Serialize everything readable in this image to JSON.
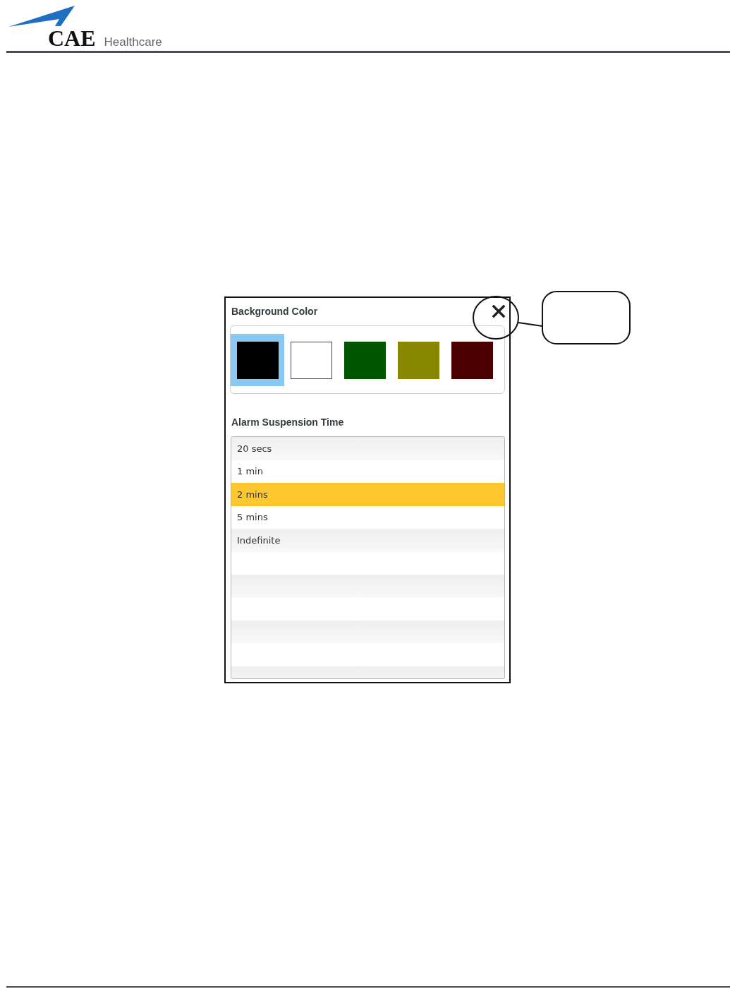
{
  "header": {
    "logo_text": "CAE",
    "logo_subtext": "Healthcare"
  },
  "dialog": {
    "background_color": {
      "label": "Background Color",
      "swatches": [
        {
          "color": "#000000",
          "selected": true
        },
        {
          "color": "#ffffff",
          "selected": false
        },
        {
          "color": "#005500",
          "selected": false
        },
        {
          "color": "#888800",
          "selected": false
        },
        {
          "color": "#4d0000",
          "selected": false
        }
      ]
    },
    "alarm_suspension_time": {
      "label": "Alarm Suspension Time",
      "options": [
        {
          "label": "20 secs",
          "selected": false
        },
        {
          "label": "1 min",
          "selected": false
        },
        {
          "label": "2 mins",
          "selected": true
        },
        {
          "label": "5 mins",
          "selected": false
        },
        {
          "label": "Indefinite",
          "selected": false
        }
      ]
    }
  }
}
